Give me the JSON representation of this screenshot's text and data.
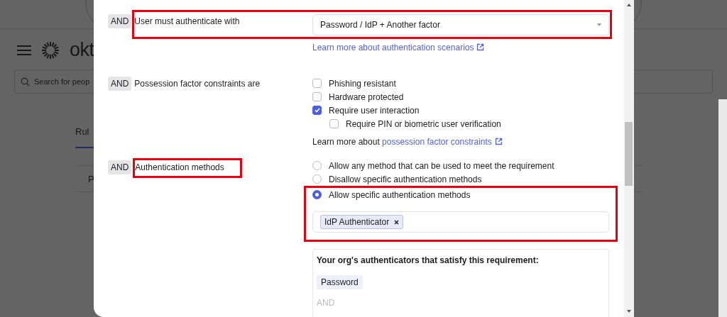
{
  "background": {
    "logo_text": "okt",
    "search": {
      "placeholder": "Search for peop"
    },
    "tab": "Rul",
    "row_text": "P"
  },
  "modal": {
    "conditions": [
      {
        "kind": "select",
        "prefix": "AND",
        "label": "User must authenticate with",
        "highlighted": true,
        "value": "Password / IdP + Another factor",
        "link": "Learn more about authentication scenarios"
      },
      {
        "kind": "checkboxes",
        "prefix": "AND",
        "label": "Possession factor constraints are",
        "highlighted": false,
        "options": [
          {
            "label": "Phishing resistant",
            "checked": false
          },
          {
            "label": "Hardware protected",
            "checked": false
          },
          {
            "label": "Require user interaction",
            "checked": true,
            "children": [
              {
                "label": "Require PIN or biometric user verification",
                "checked": false
              }
            ]
          }
        ],
        "note": "Learn more about",
        "link": "possession factor constraints"
      },
      {
        "kind": "radios",
        "prefix": "AND",
        "label": "Authentication methods",
        "highlighted": true,
        "options": [
          {
            "label": "Allow any method that can be used to meet the requirement",
            "selected": false,
            "highlighted": false
          },
          {
            "label": "Disallow specific authentication methods",
            "selected": false,
            "highlighted": false
          },
          {
            "label": "Allow specific authentication methods",
            "selected": true,
            "highlighted": true
          }
        ],
        "tags": [
          "IdP Authenticator"
        ],
        "satisfy": {
          "heading": "Your org's authenticators that satisfy this requirement:",
          "chips": [
            "Password"
          ],
          "joiner": "AND"
        }
      }
    ]
  }
}
